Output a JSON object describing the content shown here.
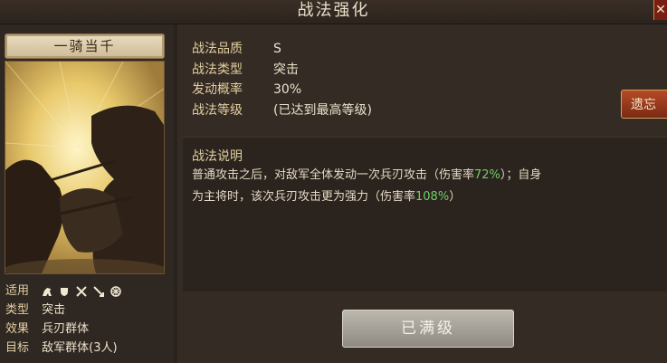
{
  "window": {
    "title": "战法强化",
    "close_icon": "close-icon"
  },
  "card": {
    "name": "一骑当千",
    "info": [
      {
        "label": "适用",
        "value": "",
        "icons": [
          "cavalry-icon",
          "shield-icon",
          "crossed-weapons-icon",
          "arrow-icon",
          "wheel-icon"
        ]
      },
      {
        "label": "类型",
        "value": "突击"
      },
      {
        "label": "效果",
        "value": "兵刃群体"
      },
      {
        "label": "目标",
        "value": "敌军群体(3人)"
      }
    ]
  },
  "stats": [
    {
      "label": "战法品质",
      "value": "S"
    },
    {
      "label": "战法类型",
      "value": "突击"
    },
    {
      "label": "发动概率",
      "value": "30%"
    },
    {
      "label": "战法等级",
      "value": "(已达到最高等级)"
    }
  ],
  "inherit_button": "遗忘",
  "description": {
    "title": "战法说明",
    "line1_a": "普通攻击之后，对敌军全体发动一次兵刃攻击（伤害率",
    "line1_b": "72%",
    "line1_c": "）；自身",
    "line2_a": "为主将时，该次兵刃攻击更为强力（伤害率",
    "line2_b": "108%",
    "line2_c": "）"
  },
  "max_button": "已满级",
  "colors": {
    "highlight_green": "#6fcf6a",
    "accent_red": "#9a3a1c"
  }
}
